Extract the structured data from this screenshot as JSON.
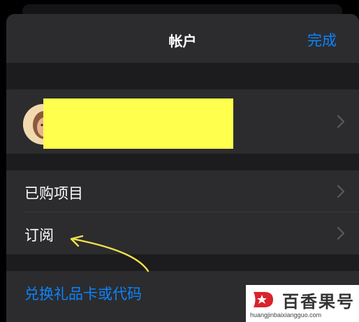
{
  "header": {
    "title": "帐户",
    "done_label": "完成"
  },
  "sections": {
    "purchased_label": "已购项目",
    "subscriptions_label": "订阅",
    "redeem_label": "兑换礼品卡或代码"
  },
  "watermark": {
    "brand": "百香果号",
    "url": "huangjinbaixiangguo.com"
  },
  "colors": {
    "accent": "#0a84ff",
    "redaction": "#ffff4d",
    "annotation_arrow": "#f2e24a"
  }
}
